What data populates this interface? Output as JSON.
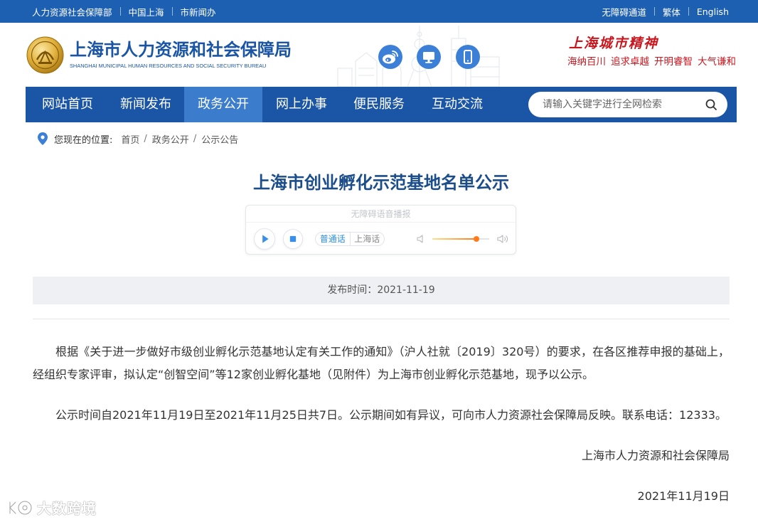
{
  "colors": {
    "topbar": "#1d5fb1",
    "nav": "#1b55a6",
    "nav_active": "#3b7dcc",
    "title": "#1b4d8b",
    "accent": "#3b7fd6",
    "slogan_red": "#c8161e",
    "brand": "#1a55a5"
  },
  "topbar": {
    "left_links": [
      "人力资源社会保障部",
      "中国上海",
      "市新闻办"
    ],
    "right_links": [
      "无障碍通道",
      "繁体",
      "English"
    ]
  },
  "header": {
    "title": "上海市人力资源和社会保障局",
    "subtitle": "SHANGHAI MUNICIPAL HUMAN RESOURCES AND SOCIAL SECURITY BUREAU",
    "social_icons": [
      "weibo-icon",
      "computer-icon",
      "mobile-icon"
    ],
    "slogan_title": "上海城市精神",
    "slogan_phrases": [
      "海纳百川",
      "追求卓越",
      "开明睿智",
      "大气谦和"
    ]
  },
  "nav": {
    "items": [
      {
        "label": "网站首页",
        "active": false
      },
      {
        "label": "新闻发布",
        "active": false
      },
      {
        "label": "政务公开",
        "active": true
      },
      {
        "label": "网上办事",
        "active": false
      },
      {
        "label": "便民服务",
        "active": false
      },
      {
        "label": "互动交流",
        "active": false
      }
    ],
    "search": {
      "placeholder": "请输入关键字进行全网检索",
      "icon": "search-icon"
    }
  },
  "breadcrumb": {
    "icon": "location-pin-icon",
    "label": "您现在的位置:",
    "separator": "/",
    "items": [
      "首页",
      "政务公开",
      "公示公告"
    ]
  },
  "article": {
    "title": "上海市创业孵化示范基地名单公示",
    "audio_player": {
      "heading": "无障碍语音播报",
      "dialects": [
        {
          "label": "普通话",
          "active": true
        },
        {
          "label": "上海话",
          "active": false
        }
      ],
      "volume": 0.78
    },
    "publish": {
      "label": "发布时间：",
      "date": "2021-11-19"
    },
    "paragraphs": [
      "根据《关于进一步做好市级创业孵化示范基地认定有关工作的通知》（沪人社就〔2019〕320号）的要求，在各区推荐申报的基础上，经组织专家评审，拟认定“创智空间”等12家创业孵化基地（见附件）为上海市创业孵化示范基地，现予以公示。",
      "公示时间自2021年11月19日至2021年11月25日共7日。公示期间如有异议，可向市人力资源社会保障局反映。联系电话：12333。"
    ],
    "signature": "上海市人力资源和社会保障局",
    "signed_date": "2021年11月19日"
  },
  "watermark": {
    "text": "大数跨境"
  }
}
